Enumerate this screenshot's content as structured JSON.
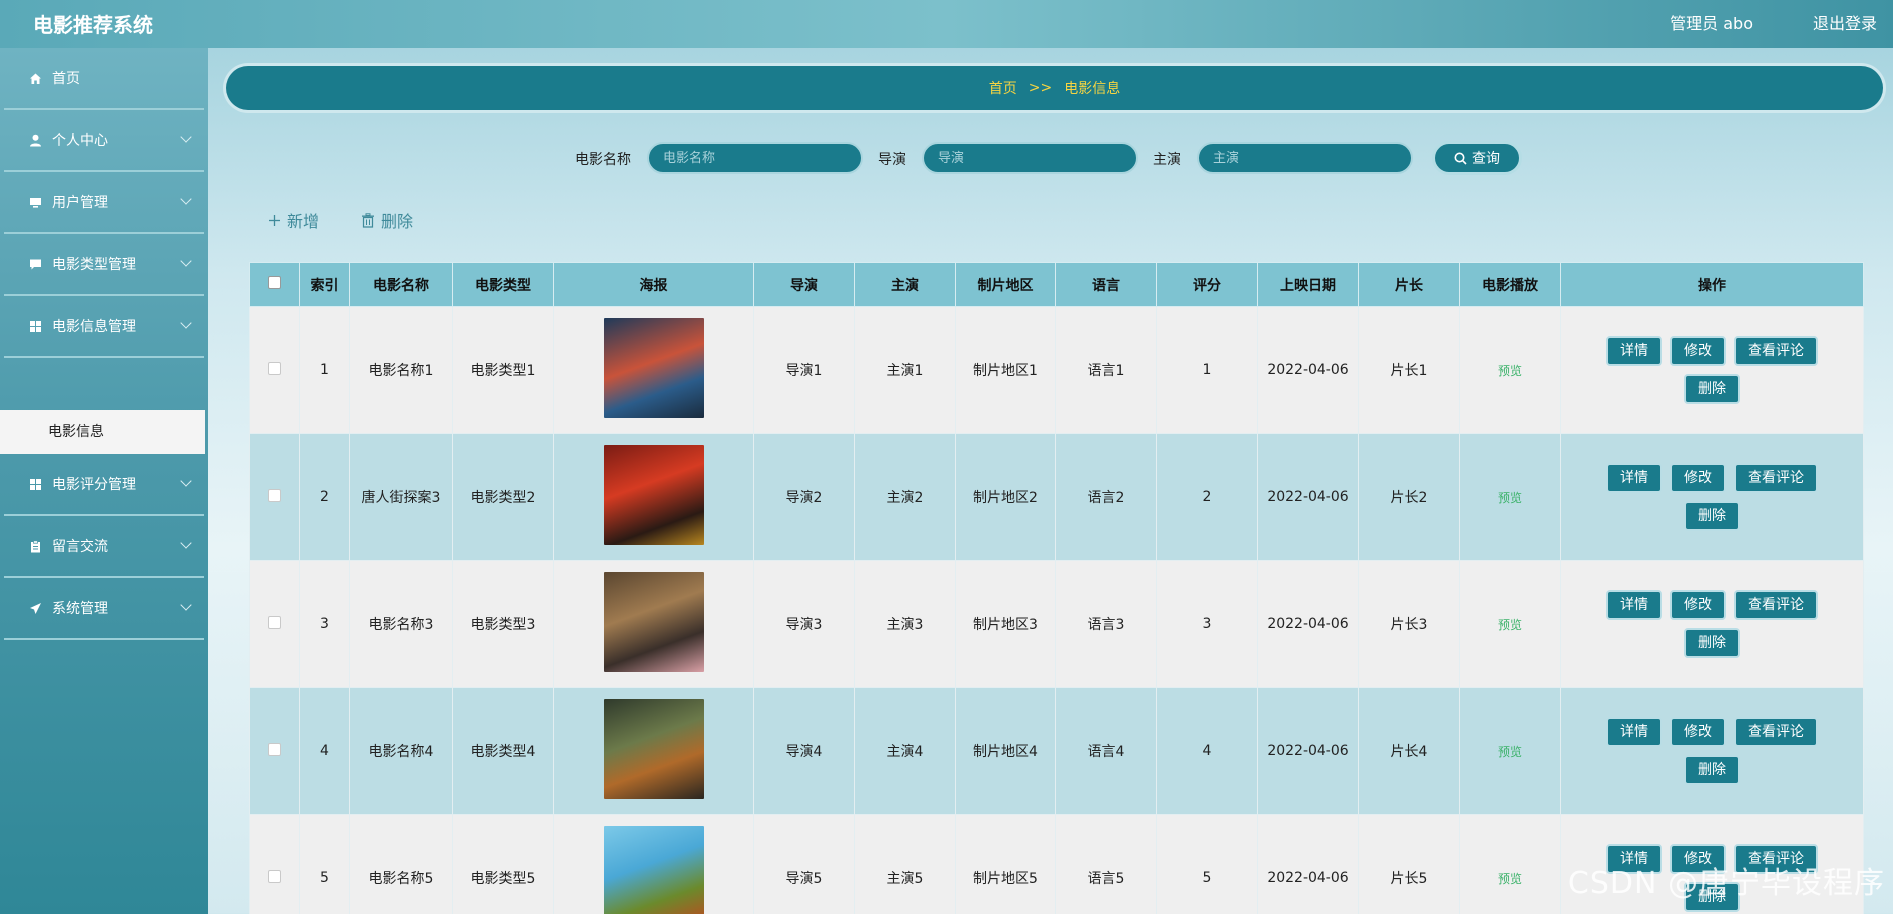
{
  "header": {
    "app_title": "电影推荐系统",
    "admin_label": "管理员 abo",
    "logout_label": "退出登录"
  },
  "sidebar": {
    "items": [
      {
        "label": "首页",
        "icon": "home-icon"
      },
      {
        "label": "个人中心",
        "icon": "user-icon"
      },
      {
        "label": "用户管理",
        "icon": "monitor-icon"
      },
      {
        "label": "电影类型管理",
        "icon": "chat-icon"
      },
      {
        "label": "电影信息管理",
        "icon": "grid-icon"
      },
      {
        "label": "电影评分管理",
        "icon": "grid-icon"
      },
      {
        "label": "留言交流",
        "icon": "clipboard-icon"
      },
      {
        "label": "系统管理",
        "icon": "send-icon"
      }
    ],
    "active_sub_item": "电影信息"
  },
  "breadcrumb": {
    "home": "首页",
    "separator": ">>",
    "current": "电影信息"
  },
  "search": {
    "name_label": "电影名称",
    "name_placeholder": "电影名称",
    "director_label": "导演",
    "director_placeholder": "导演",
    "actor_label": "主演",
    "actor_placeholder": "主演",
    "button_label": "查询"
  },
  "toolbar": {
    "add_label": "新增",
    "delete_label": "删除"
  },
  "table": {
    "headers": [
      "索引",
      "电影名称",
      "电影类型",
      "海报",
      "导演",
      "主演",
      "制片地区",
      "语言",
      "评分",
      "上映日期",
      "片长",
      "电影播放",
      "操作"
    ],
    "rows": [
      {
        "index": "1",
        "name": "电影名称1",
        "type": "电影类型1",
        "director": "导演1",
        "actor": "主演1",
        "region": "制片地区1",
        "language": "语言1",
        "score": "1",
        "date": "2022-04-06",
        "length": "片长1",
        "play": "预览"
      },
      {
        "index": "2",
        "name": "唐人街探案3",
        "type": "电影类型2",
        "director": "导演2",
        "actor": "主演2",
        "region": "制片地区2",
        "language": "语言2",
        "score": "2",
        "date": "2022-04-06",
        "length": "片长2",
        "play": "预览"
      },
      {
        "index": "3",
        "name": "电影名称3",
        "type": "电影类型3",
        "director": "导演3",
        "actor": "主演3",
        "region": "制片地区3",
        "language": "语言3",
        "score": "3",
        "date": "2022-04-06",
        "length": "片长3",
        "play": "预览"
      },
      {
        "index": "4",
        "name": "电影名称4",
        "type": "电影类型4",
        "director": "导演4",
        "actor": "主演4",
        "region": "制片地区4",
        "language": "语言4",
        "score": "4",
        "date": "2022-04-06",
        "length": "片长4",
        "play": "预览"
      },
      {
        "index": "5",
        "name": "电影名称5",
        "type": "电影类型5",
        "director": "导演5",
        "actor": "主演5",
        "region": "制片地区5",
        "language": "语言5",
        "score": "5",
        "date": "2022-04-06",
        "length": "片长5",
        "play": "预览"
      }
    ],
    "actions": {
      "detail": "详情",
      "edit": "修改",
      "comments": "查看评论",
      "delete": "删除"
    }
  },
  "watermark": "CSDN @唐宁毕设程序",
  "colors": {
    "accent": "#1a7b8c",
    "header_row": "#7ec3d1",
    "breadcrumb_text": "#f5d442",
    "preview_link": "#3bb26a"
  }
}
